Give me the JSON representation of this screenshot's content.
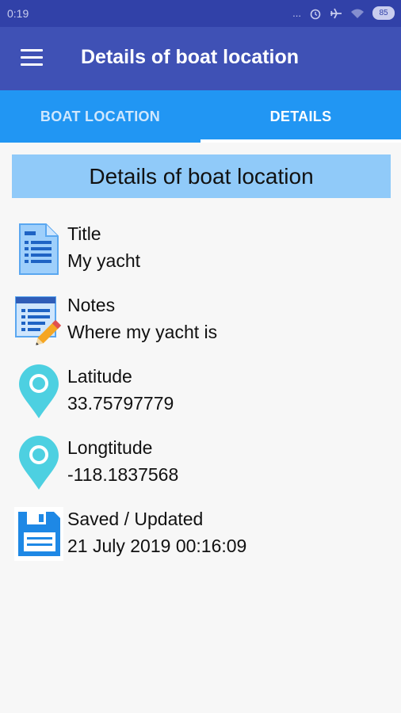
{
  "status_bar": {
    "time": "0:19",
    "dots": "...",
    "battery": "85"
  },
  "app_bar": {
    "title": "Details of boat location"
  },
  "tabs": [
    {
      "label": "BOAT LOCATION",
      "active": false
    },
    {
      "label": "DETAILS",
      "active": true
    }
  ],
  "section": {
    "title": "Details of boat location"
  },
  "details": {
    "title": {
      "label": "Title",
      "value": "My yacht",
      "icon": "document-icon"
    },
    "notes": {
      "label": "Notes",
      "value": "Where my yacht is",
      "icon": "notes-edit-icon"
    },
    "latitude": {
      "label": "Latitude",
      "value": "33.75797779",
      "icon": "location-pin-icon"
    },
    "longitude": {
      "label": "Longtitude",
      "value": "-118.1837568",
      "icon": "location-pin-icon"
    },
    "saved": {
      "label": "Saved / Updated",
      "value": "21 July 2019 00:16:09",
      "icon": "save-icon"
    }
  },
  "colors": {
    "status_bar": "#3141a8",
    "app_bar": "#3f51b5",
    "tab_bar": "#2196f3",
    "section_header": "#90caf9",
    "pin": "#4dd0e1",
    "save_icon": "#1e88e5"
  }
}
